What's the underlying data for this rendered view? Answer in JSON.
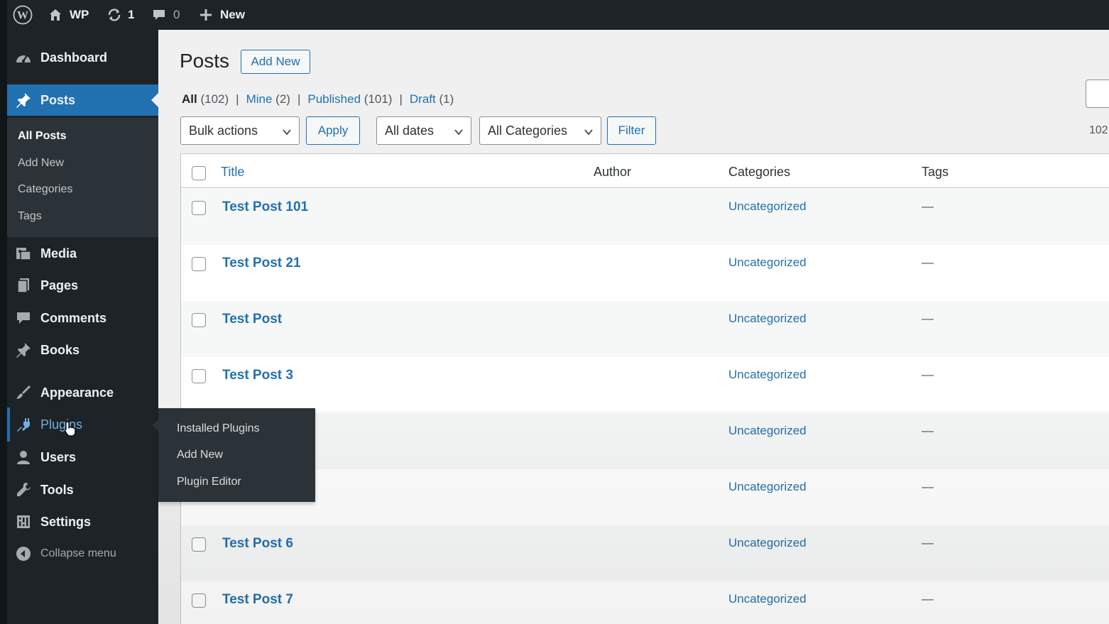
{
  "adminbar": {
    "site_name": "WP",
    "updates_count": "1",
    "comments_count": "0",
    "new_label": "New"
  },
  "sidebar": {
    "items": [
      {
        "label": "Dashboard",
        "icon": "dashboard-icon"
      },
      {
        "label": "Posts",
        "icon": "pushpin-icon",
        "active": true
      },
      {
        "label": "Media",
        "icon": "media-icon"
      },
      {
        "label": "Pages",
        "icon": "pages-icon"
      },
      {
        "label": "Comments",
        "icon": "comment-icon"
      },
      {
        "label": "Books",
        "icon": "pushpin-icon"
      },
      {
        "label": "Appearance",
        "icon": "paintbrush-icon"
      },
      {
        "label": "Plugins",
        "icon": "plugin-icon",
        "hovered": true
      },
      {
        "label": "Users",
        "icon": "user-icon"
      },
      {
        "label": "Tools",
        "icon": "wrench-icon"
      },
      {
        "label": "Settings",
        "icon": "settings-icon"
      }
    ],
    "submenu": [
      "All Posts",
      "Add New",
      "Categories",
      "Tags"
    ],
    "collapse_label": "Collapse menu"
  },
  "plugins_flyout": [
    "Installed Plugins",
    "Add New",
    "Plugin Editor"
  ],
  "main": {
    "title": "Posts",
    "add_new_label": "Add New",
    "views": [
      {
        "label": "All",
        "count": "(102)"
      },
      {
        "label": "Mine",
        "count": "(2)"
      },
      {
        "label": "Published",
        "count": "(101)"
      },
      {
        "label": "Draft",
        "count": "(1)"
      }
    ],
    "bulk_actions": "Bulk actions",
    "apply_label": "Apply",
    "dates_filter": "All dates",
    "categories_filter": "All Categories",
    "filter_label": "Filter",
    "item_count": "102",
    "columns": [
      "Title",
      "Author",
      "Categories",
      "Tags"
    ],
    "rows": [
      {
        "title": "Test Post 101",
        "category": "Uncategorized",
        "tags": "—"
      },
      {
        "title": "Test Post 21",
        "category": "Uncategorized",
        "tags": "—"
      },
      {
        "title": "Test Post",
        "category": "Uncategorized",
        "tags": "—"
      },
      {
        "title": "Test Post 3",
        "category": "Uncategorized",
        "tags": "—"
      },
      {
        "title": "",
        "category": "Uncategorized",
        "tags": "—"
      },
      {
        "title": "",
        "category": "Uncategorized",
        "tags": "—"
      },
      {
        "title": "Test Post 6",
        "category": "Uncategorized",
        "tags": "—"
      },
      {
        "title": "Test Post 7",
        "category": "Uncategorized",
        "tags": "—"
      }
    ]
  },
  "colors": {
    "adminbar_bg": "#1d2327",
    "sidebar_bg": "#1d2327",
    "submenu_bg": "#2c3338",
    "accent": "#2271b1",
    "content_bg": "#f0f0f1"
  }
}
